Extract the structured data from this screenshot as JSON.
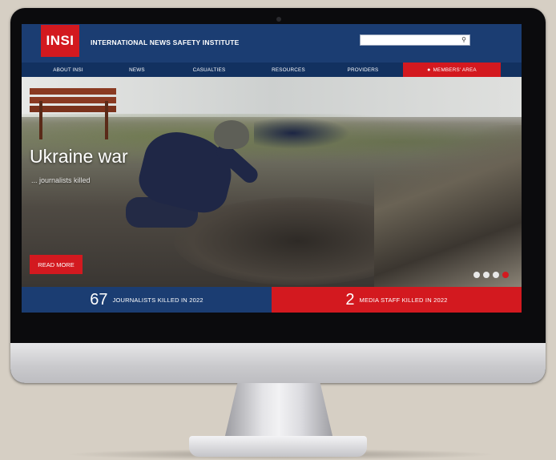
{
  "site": {
    "logo_text": "INSI",
    "name": "INTERNATIONAL NEWS SAFETY INSTITUTE",
    "search_placeholder": ""
  },
  "nav": {
    "items": [
      {
        "label": "ABOUT INSI"
      },
      {
        "label": "NEWS"
      },
      {
        "label": "CASUALTIES"
      },
      {
        "label": "RESOURCES"
      },
      {
        "label": "PROVIDERS"
      },
      {
        "label": "MEMBERS' AREA",
        "icon": "person-icon"
      }
    ]
  },
  "hero": {
    "title": "Ukraine war",
    "subtitle": "... journalists killed",
    "cta_label": "READ MORE",
    "slides_count": 4,
    "active_slide": 4
  },
  "stats": [
    {
      "number": "67",
      "label": "JOURNALISTS KILLED IN 2022"
    },
    {
      "number": "2",
      "label": "MEDIA STAFF KILLED IN 2022"
    }
  ],
  "colors": {
    "brand_red": "#d3191f",
    "brand_blue": "#1b3d72"
  }
}
